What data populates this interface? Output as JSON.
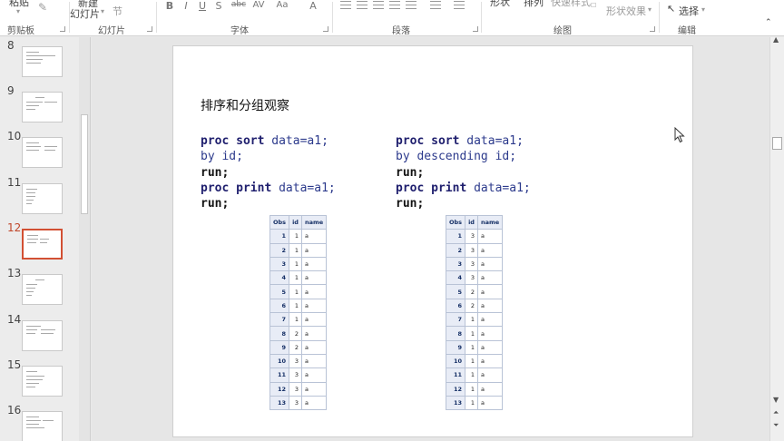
{
  "ribbon": {
    "paste_label": "粘贴",
    "new_slide_top": "新建",
    "new_slide_bottom": "幻灯片",
    "section_label": "节",
    "bold": "B",
    "italic": "I",
    "underline": "U",
    "strike": "S",
    "abc": "abc",
    "spacing": "AV",
    "case": "Aa",
    "font_color": "A",
    "shapes_label": "形状",
    "arrange_label": "排列",
    "quick_styles_label": "快速样式",
    "shape_effects_label": "形状效果",
    "select_label": "选择",
    "groups": [
      "剪贴板",
      "幻灯片",
      "字体",
      "段落",
      "绘图",
      "编辑"
    ]
  },
  "thumbnails": [
    {
      "num": "8",
      "active": false
    },
    {
      "num": "9",
      "active": false
    },
    {
      "num": "10",
      "active": false
    },
    {
      "num": "11",
      "active": false
    },
    {
      "num": "12",
      "active": true
    },
    {
      "num": "13",
      "active": false
    },
    {
      "num": "14",
      "active": false
    },
    {
      "num": "15",
      "active": false
    },
    {
      "num": "16",
      "active": false
    }
  ],
  "slide": {
    "title": "排序和分组观察",
    "code_left": [
      [
        [
          "kw",
          "proc sort"
        ],
        [
          "arg",
          " data=a1;"
        ]
      ],
      [
        [
          "arg",
          "by id;"
        ]
      ],
      [
        [
          "kw-dark",
          "run;"
        ]
      ],
      [
        [
          "kw",
          "proc print"
        ],
        [
          "arg",
          " data=a1;"
        ]
      ],
      [
        [
          "kw-dark",
          "run;"
        ]
      ]
    ],
    "code_right": [
      [
        [
          "kw",
          "proc sort"
        ],
        [
          "arg",
          " data=a1;"
        ]
      ],
      [
        [
          "arg",
          "by descending id;"
        ]
      ],
      [
        [
          "kw-dark",
          "run;"
        ]
      ],
      [
        [
          "kw",
          "proc print"
        ],
        [
          "arg",
          " data=a1;"
        ]
      ],
      [
        [
          "kw-dark",
          "run;"
        ]
      ]
    ],
    "table_headers": [
      "Obs",
      "id",
      "name"
    ],
    "table_left": [
      [
        "1",
        "1",
        "a"
      ],
      [
        "2",
        "1",
        "a"
      ],
      [
        "3",
        "1",
        "a"
      ],
      [
        "4",
        "1",
        "a"
      ],
      [
        "5",
        "1",
        "a"
      ],
      [
        "6",
        "1",
        "a"
      ],
      [
        "7",
        "1",
        "a"
      ],
      [
        "8",
        "2",
        "a"
      ],
      [
        "9",
        "2",
        "a"
      ],
      [
        "10",
        "3",
        "a"
      ],
      [
        "11",
        "3",
        "a"
      ],
      [
        "12",
        "3",
        "a"
      ],
      [
        "13",
        "3",
        "a"
      ]
    ],
    "table_right": [
      [
        "1",
        "3",
        "a"
      ],
      [
        "2",
        "3",
        "a"
      ],
      [
        "3",
        "3",
        "a"
      ],
      [
        "4",
        "3",
        "a"
      ],
      [
        "5",
        "2",
        "a"
      ],
      [
        "6",
        "2",
        "a"
      ],
      [
        "7",
        "1",
        "a"
      ],
      [
        "8",
        "1",
        "a"
      ],
      [
        "9",
        "1",
        "a"
      ],
      [
        "10",
        "1",
        "a"
      ],
      [
        "11",
        "1",
        "a"
      ],
      [
        "12",
        "1",
        "a"
      ],
      [
        "13",
        "1",
        "a"
      ]
    ]
  },
  "colors": {
    "accent": "#d25033",
    "keyword": "#1f1f6e",
    "table_header_bg": "#e8ecf6"
  }
}
